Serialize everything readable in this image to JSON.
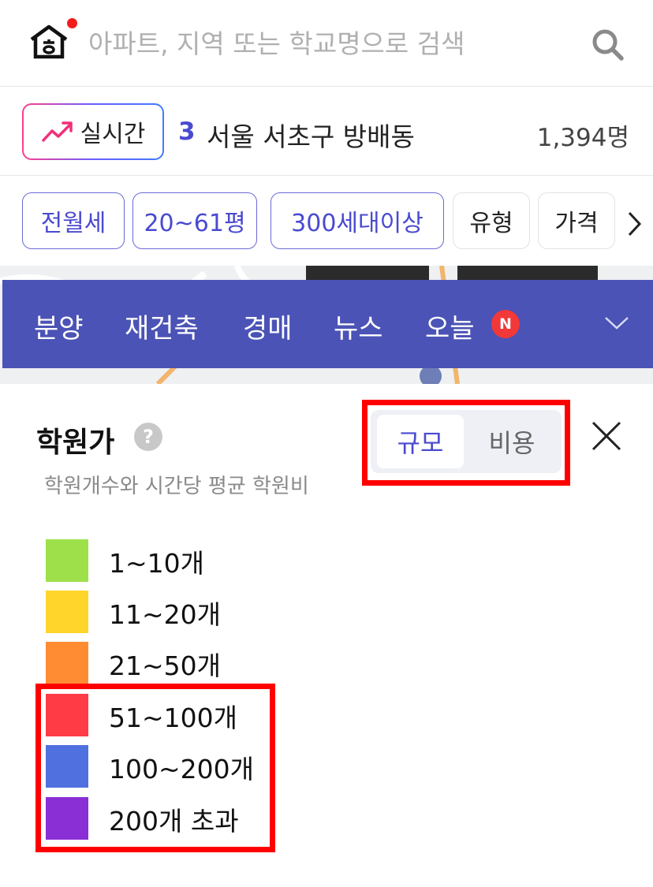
{
  "search": {
    "placeholder": "아파트, 지역 또는 학교명으로 검색"
  },
  "realtime": {
    "badge_label": "실시간",
    "rank": "3",
    "place": "서울 서초구 방배동",
    "count": "1,394명"
  },
  "filters": [
    {
      "label": "전월세",
      "active": true
    },
    {
      "label": "20~61평",
      "active": true
    },
    {
      "label": "300세대이상",
      "active": true
    },
    {
      "label": "유형",
      "active": false
    },
    {
      "label": "가격",
      "active": false
    }
  ],
  "nav": {
    "items": [
      "분양",
      "재건축",
      "경매",
      "뉴스",
      "오늘"
    ],
    "new_badge": "N"
  },
  "panel": {
    "title": "학원가",
    "help": "?",
    "subtitle": "학원개수와 시간당 평균 학원비",
    "toggle": {
      "active": "규모",
      "inactive": "비용"
    },
    "legend": [
      {
        "label": "1~10개",
        "color": "#9ee04a"
      },
      {
        "label": "11~20개",
        "color": "#ffd52c"
      },
      {
        "label": "21~50개",
        "color": "#ff8b33"
      },
      {
        "label": "51~100개",
        "color": "#ff3b45"
      },
      {
        "label": "100~200개",
        "color": "#5070e0"
      },
      {
        "label": "200개 초과",
        "color": "#8a2ed6"
      }
    ]
  },
  "colors": {
    "accent": "#4a4ad0",
    "nav_bg": "#4b53b6",
    "annotation": "#ff0000"
  }
}
